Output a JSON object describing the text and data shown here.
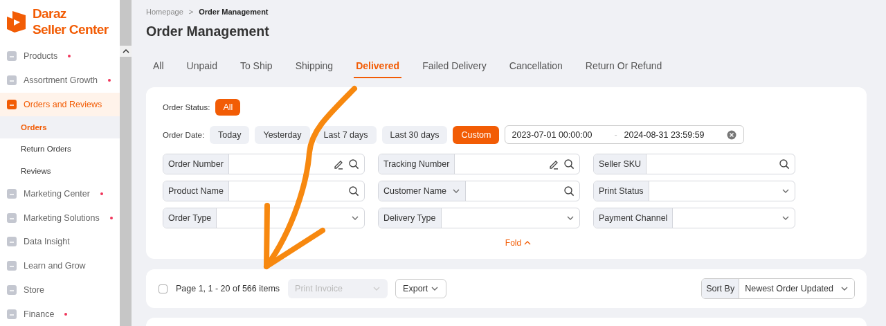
{
  "logo": {
    "line_1": "Daraz",
    "line_2": "Seller Center"
  },
  "sidebar": {
    "items": [
      {
        "label": "Products",
        "dot": true,
        "selected": false
      },
      {
        "label": "Assortment Growth",
        "dot": true,
        "selected": false
      },
      {
        "label": "Orders and Reviews",
        "dot": false,
        "selected": true,
        "children": [
          {
            "label": "Orders",
            "selected": true
          },
          {
            "label": "Return Orders",
            "selected": false
          },
          {
            "label": "Reviews",
            "selected": false
          }
        ]
      },
      {
        "label": "Marketing Center",
        "dot": true,
        "selected": false
      },
      {
        "label": "Marketing Solutions",
        "dot": true,
        "selected": false
      },
      {
        "label": "Data Insight",
        "dot": false,
        "selected": false
      },
      {
        "label": "Learn and Grow",
        "dot": false,
        "selected": false
      },
      {
        "label": "Store",
        "dot": false,
        "selected": false
      },
      {
        "label": "Finance",
        "dot": true,
        "selected": false
      }
    ]
  },
  "breadcrumb": {
    "parent": "Homepage",
    "separator": ">",
    "current": "Order Management"
  },
  "title": "Order Management",
  "tabs": [
    {
      "label": "All",
      "selected": false
    },
    {
      "label": "Unpaid",
      "selected": false
    },
    {
      "label": "To Ship",
      "selected": false
    },
    {
      "label": "Shipping",
      "selected": false
    },
    {
      "label": "Delivered",
      "selected": true
    },
    {
      "label": "Failed Delivery",
      "selected": false
    },
    {
      "label": "Cancellation",
      "selected": false
    },
    {
      "label": "Return Or Refund",
      "selected": false
    }
  ],
  "filters": {
    "status_label": "Order Status:",
    "statuses": [
      {
        "label": "All",
        "selected": true
      }
    ],
    "date_label": "Order Date:",
    "dates": [
      {
        "label": "Today",
        "selected": false
      },
      {
        "label": "Yesterday",
        "selected": false
      },
      {
        "label": "Last 7 days",
        "selected": false
      },
      {
        "label": "Last 30 days",
        "selected": false
      },
      {
        "label": "Custom",
        "selected": true
      }
    ],
    "date_range": {
      "start": "2023-07-01 00:00:00",
      "separator": "-",
      "end": "2024-08-31 23:59:59"
    },
    "fields": [
      {
        "label": "Order Number",
        "kind": "search",
        "edit": true
      },
      {
        "label": "Tracking Number",
        "kind": "search",
        "edit": true
      },
      {
        "label": "Seller SKU",
        "kind": "search",
        "edit": false
      },
      {
        "label": "Product Name",
        "kind": "search",
        "edit": false
      },
      {
        "label": "Customer Name",
        "kind": "search",
        "edit": false,
        "label_dropdown": true
      },
      {
        "label": "Print Status",
        "kind": "select"
      },
      {
        "label": "Order Type",
        "kind": "select"
      },
      {
        "label": "Delivery Type",
        "kind": "select"
      },
      {
        "label": "Payment Channel",
        "kind": "select"
      }
    ],
    "fold": "Fold"
  },
  "toolbar": {
    "checked": false,
    "page_info": "Page 1, 1 - 20 of 566 items",
    "print_invoice": {
      "label": "Print Invoice",
      "disabled": true
    },
    "export": "Export",
    "sort_label": "Sort By",
    "sort_value": "Newest Order Updated"
  }
}
